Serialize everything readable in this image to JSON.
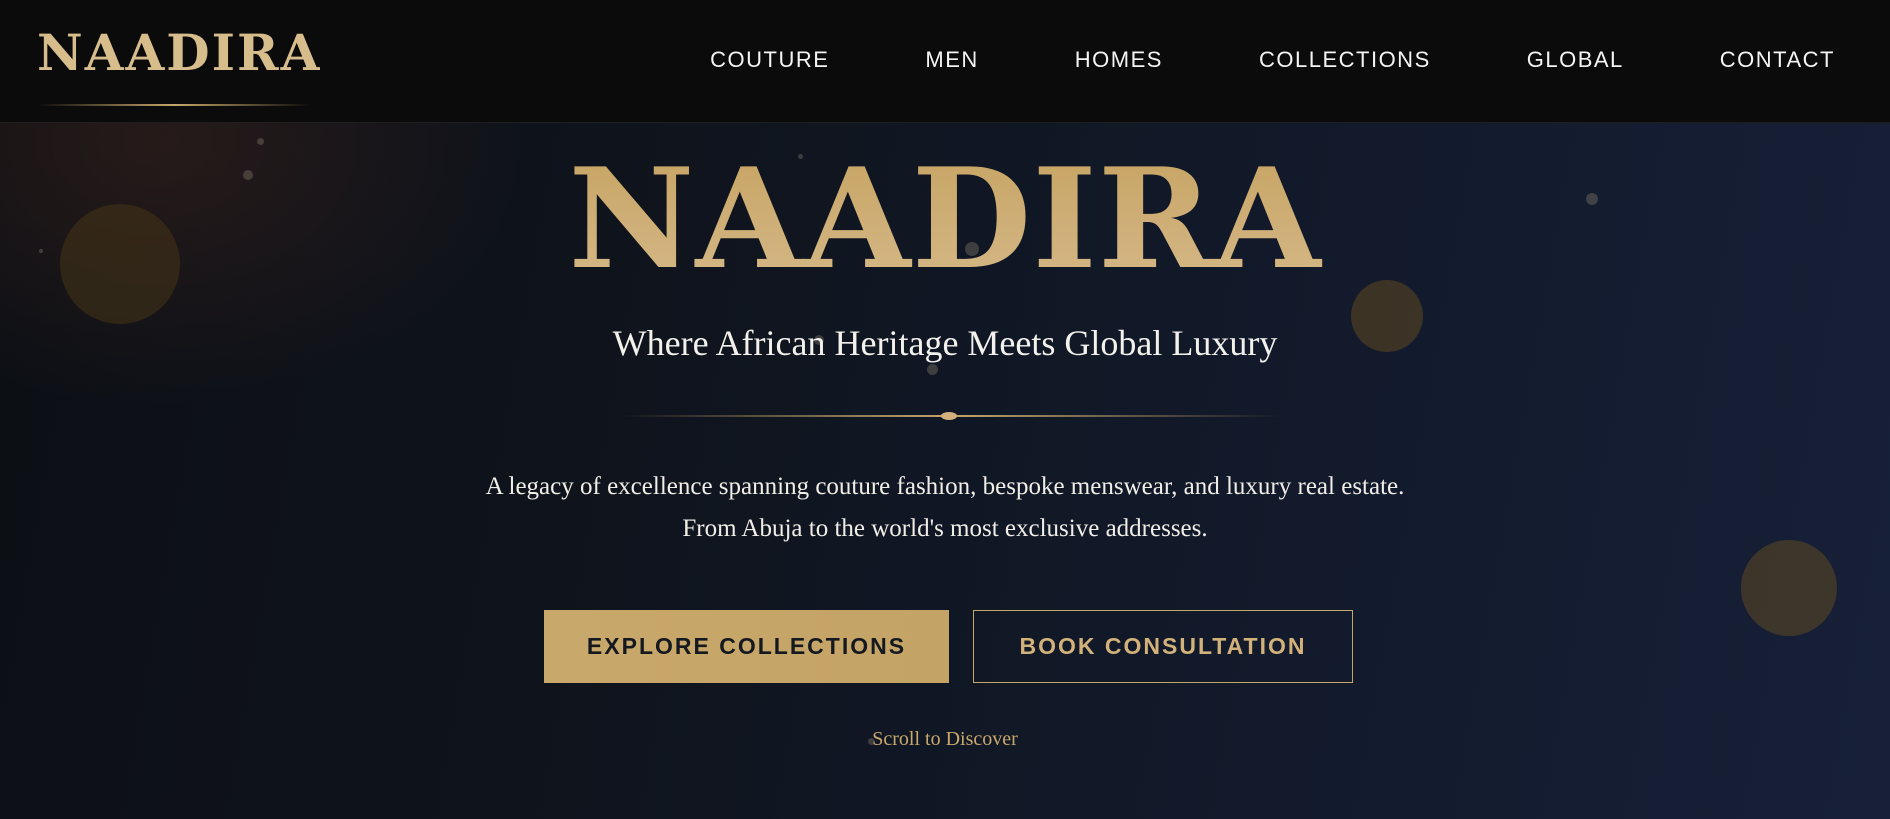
{
  "header": {
    "logo": "NAADIRA",
    "nav": [
      {
        "label": "COUTURE"
      },
      {
        "label": "MEN"
      },
      {
        "label": "HOMES"
      },
      {
        "label": "COLLECTIONS"
      },
      {
        "label": "GLOBAL"
      },
      {
        "label": "CONTACT"
      }
    ]
  },
  "hero": {
    "title": "NAADIRA",
    "subtitle": "Where African Heritage Meets Global Luxury",
    "description_lines": [
      "A legacy of excellence spanning couture fashion, bespoke menswear, and luxury real estate.",
      "From Abuja to the world's most exclusive addresses."
    ],
    "primary_button": "EXPLORE COLLECTIONS",
    "secondary_button": "BOOK CONSULTATION",
    "scroll_hint": "Scroll to Discover"
  },
  "colors": {
    "gold": "#c9a86c",
    "header_bg": "#0b0b0b",
    "hero_bg_dark": "#0d1017",
    "hero_bg_navy": "#172038",
    "text_light": "#f3f1ec"
  }
}
